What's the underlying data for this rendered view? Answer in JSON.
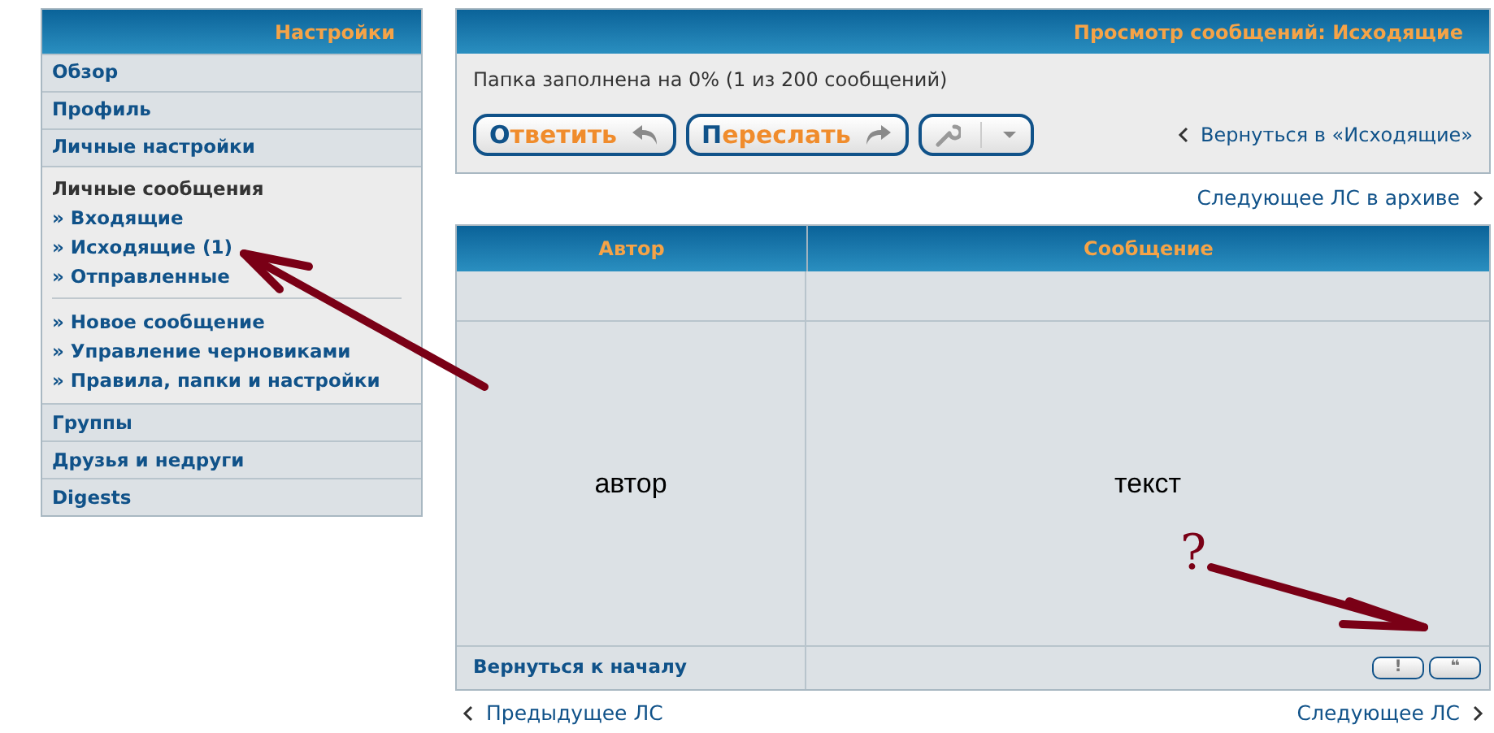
{
  "sidebar": {
    "title": "Настройки",
    "items": [
      {
        "label": "Обзор",
        "expanded": false
      },
      {
        "label": "Профиль",
        "expanded": false
      },
      {
        "label": "Личные настройки",
        "expanded": false
      },
      {
        "label": "Личные сообщения",
        "expanded": true,
        "groups": [
          [
            "» Входящие",
            "» Исходящие (1)",
            "» Отправленные"
          ],
          [
            "» Новое сообщение",
            "» Управление черновиками",
            "» Правила, папки и настройки"
          ]
        ]
      },
      {
        "label": "Группы",
        "expanded": false
      },
      {
        "label": "Друзья и недруги",
        "expanded": false
      },
      {
        "label": "Digests",
        "expanded": false
      }
    ]
  },
  "panel": {
    "title": "Просмотр сообщений: Исходящие",
    "folder_status": "Папка заполнена на 0% (1 из 200 сообщений)",
    "buttons": [
      {
        "kind": "reply",
        "label": "Ответить"
      },
      {
        "kind": "forward",
        "label": "Переслать"
      },
      {
        "kind": "tools"
      }
    ],
    "back_link": "Вернуться в «Исходящие»"
  },
  "archive_link": "Следующее ЛС в архиве",
  "table": {
    "columns": [
      "Автор",
      "Сообщение"
    ],
    "author": "автор",
    "message": "текст",
    "back_to_top": "Вернуться к началу",
    "post_buttons": [
      "!",
      "❝"
    ]
  },
  "prev_link": "Предыдущее ЛС",
  "next_link": "Следующее ЛС",
  "annotation": {
    "mark": "?"
  }
}
